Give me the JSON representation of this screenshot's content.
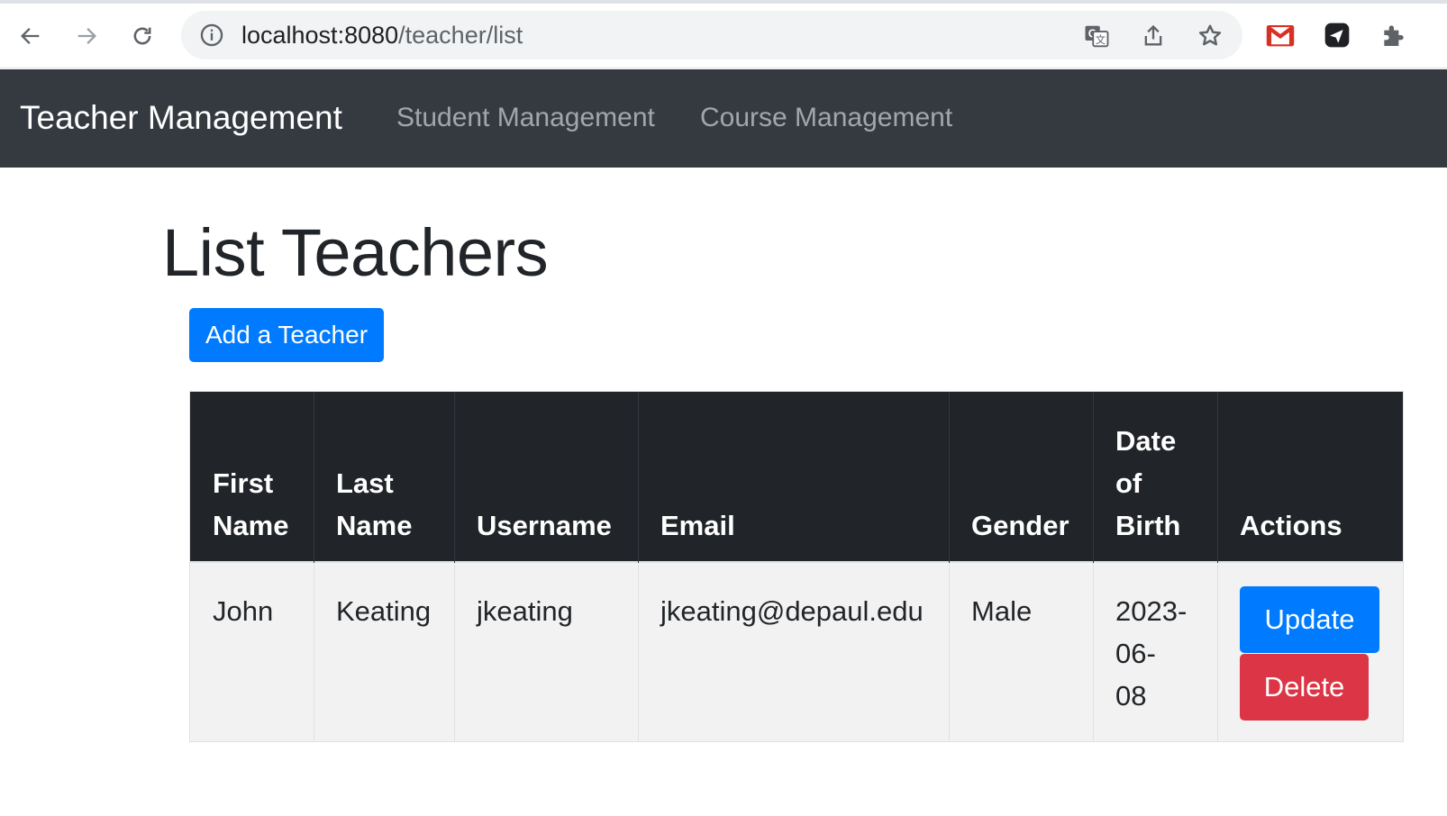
{
  "browser": {
    "url_host": "localhost:8080",
    "url_path": "/teacher/list"
  },
  "navbar": {
    "brand": "Teacher Management",
    "links": [
      "Student Management",
      "Course Management"
    ]
  },
  "page": {
    "title": "List Teachers",
    "add_button": "Add a Teacher"
  },
  "table": {
    "headers": [
      [
        "First",
        "Name"
      ],
      [
        "Last",
        "Name"
      ],
      [
        "Username"
      ],
      [
        "Email"
      ],
      [
        "Gender"
      ],
      [
        "Date",
        "of",
        "Birth"
      ],
      [
        "Actions"
      ]
    ],
    "rows": [
      {
        "first_name": "John",
        "last_name": "Keating",
        "username": "jkeating",
        "email": "jkeating@depaul.edu",
        "gender": "Male",
        "dob": [
          "2023-",
          "06-",
          "08"
        ],
        "update_label": "Update",
        "delete_label": "Delete"
      }
    ]
  },
  "colors": {
    "navbar_bg": "#343a40",
    "primary": "#007bff",
    "danger": "#dc3545",
    "table_head_bg": "#212529",
    "row_stripe_bg": "#f2f2f2"
  }
}
